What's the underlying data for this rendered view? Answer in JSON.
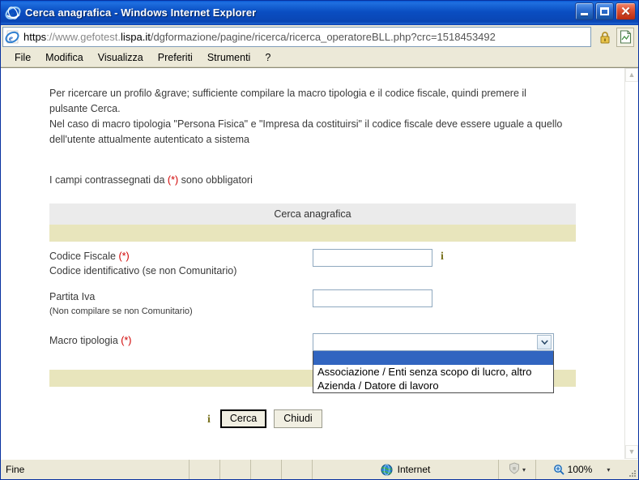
{
  "window": {
    "title": "Cerca anagrafica - Windows Internet Explorer",
    "app_icon": "ie-logo-icon",
    "minimize_label": "",
    "maximize_label": "",
    "close_label": "✕"
  },
  "address_bar": {
    "scheme": "https",
    "sep": "://www.",
    "host_plain": "gefotest.",
    "host_strong": "lispa.it",
    "path": "/dgformazione/pagine/ricerca/ricerca_operatoreBLL.php?crc=1518453492",
    "full_url": "https://www.gefotest.lispa.it/dgformazione/pagine/ricerca/ricerca_operatoreBLL.php?crc=1518453492",
    "lock_icon": "padlock-icon",
    "page_icon": "page-icon"
  },
  "menu": {
    "items": [
      {
        "label": "File"
      },
      {
        "label": "Modifica"
      },
      {
        "label": "Visualizza"
      },
      {
        "label": "Preferiti"
      },
      {
        "label": "Strumenti"
      },
      {
        "label": "?"
      }
    ]
  },
  "page": {
    "intro_line1": "Per ricercare un profilo &grave; sufficiente compilare la macro tipologia e il codice fiscale, quindi premere il",
    "intro_line2": "pulsante Cerca.",
    "intro_line3": "Nel caso di macro tipologia \"Persona Fisica\" e \"Impresa da costituirsi\" il codice fiscale deve essere uguale a quello",
    "intro_line4": "dell'utente attualmente autenticato a sistema",
    "required_note_pre": "I campi contrassegnati da ",
    "required_note_mark": "(*)",
    "required_note_post": " sono obbligatori",
    "table_title": "Cerca anagrafica",
    "fields": [
      {
        "label_main": "Codice Fiscale ",
        "label_mark": "(*)",
        "label_sub": "Codice identificativo (se non Comunitario)",
        "value": "",
        "has_info_icon": true,
        "info_icon": "info-i-icon"
      },
      {
        "label_main": "Partita Iva",
        "label_mark": "",
        "label_sub": "(Non compilare se non Comunitario)",
        "value": "",
        "has_info_icon": false,
        "info_icon": ""
      }
    ],
    "macro": {
      "label_main": "Macro tipologia ",
      "label_mark": "(*)",
      "selected_value": "",
      "dropdown_open": true,
      "options": [
        {
          "label": "",
          "selected": true
        },
        {
          "label": "Associazione / Enti senza scopo di lucro, altro",
          "selected": false
        },
        {
          "label": "Azienda / Datore di lavoro",
          "selected": false
        }
      ]
    },
    "actions": {
      "info_icon": "info-i-icon",
      "search_label": "Cerca",
      "close_label": "Chiudi",
      "focused_button": "Cerca"
    }
  },
  "status_bar": {
    "text": "Fine",
    "zone_label": "Internet",
    "zone_icon": "globe-icon",
    "shield_icon": "shield-icon",
    "zoom_label": "100%",
    "zoom_icon": "magnifier-icon",
    "dropdown_caret": "▾"
  },
  "colors": {
    "titlebar_blue": "#0a4ec2",
    "chrome_beige": "#ece9d8",
    "table_header_gray": "#ebebeb",
    "table_band_khaki": "#e8e5bc",
    "required_red": "#d00000",
    "info_olive": "#7a7320",
    "select_highlight_blue": "#3165c0",
    "input_border": "#8fa8bf"
  }
}
